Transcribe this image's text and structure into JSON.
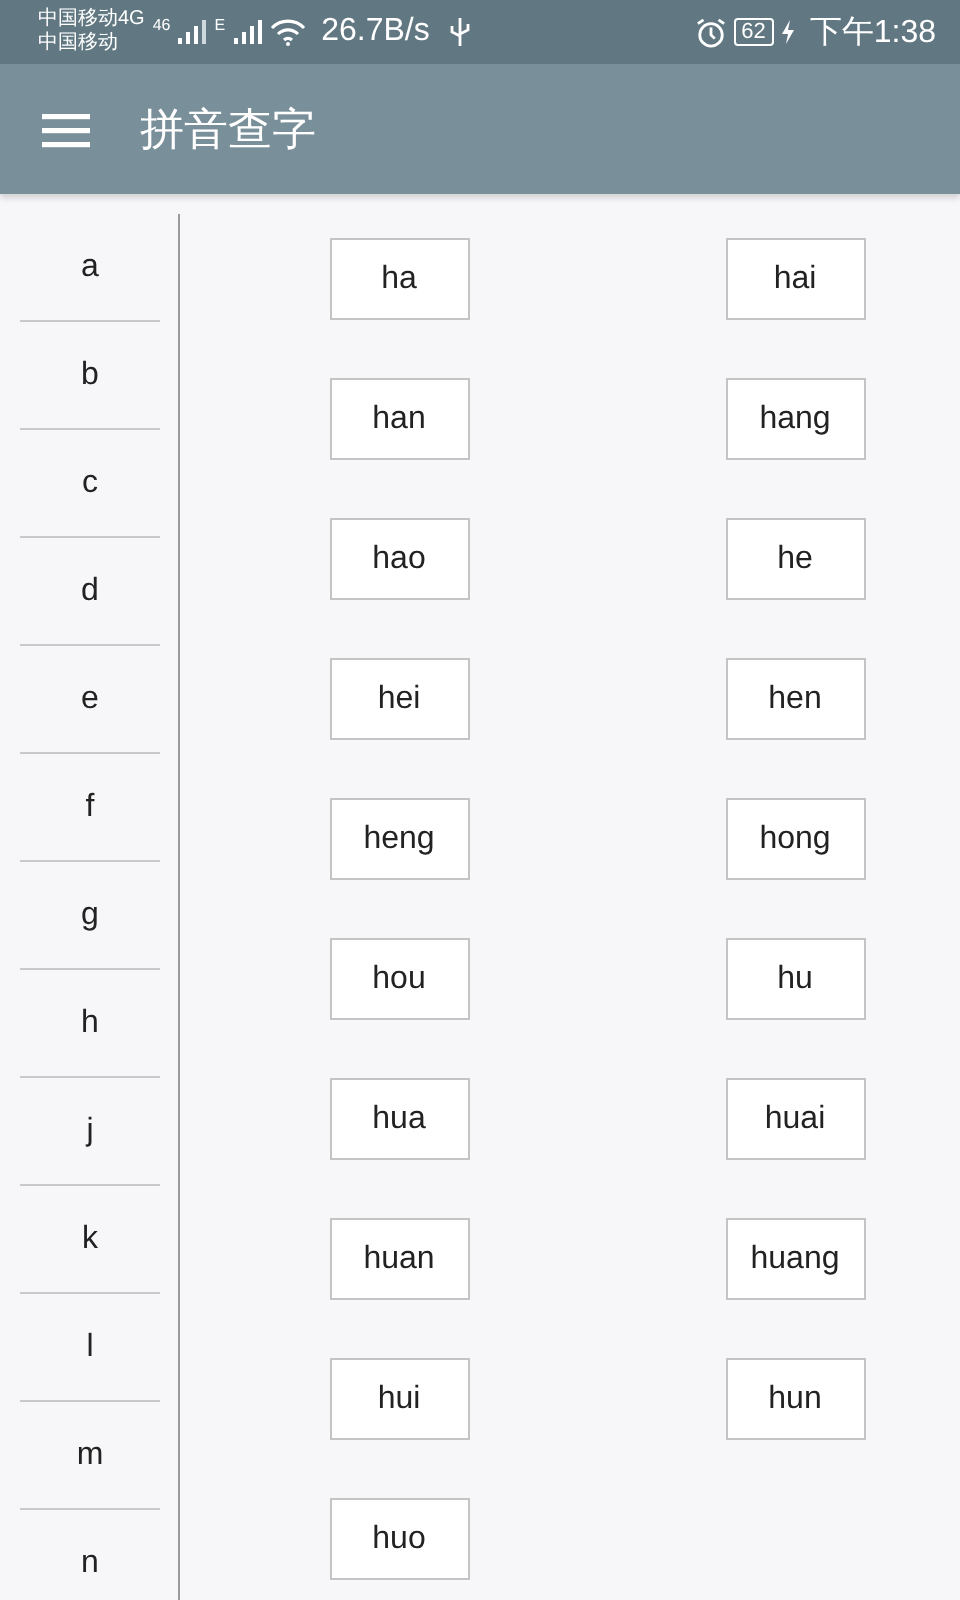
{
  "status_bar": {
    "carrier_1": "中国移动4G",
    "carrier_2": "中国移动",
    "network_1": "46",
    "network_2": "E",
    "speed": "26.7B/s",
    "battery": "62",
    "time": "下午1:38"
  },
  "app_bar": {
    "title": "拼音查字"
  },
  "letters": [
    "a",
    "b",
    "c",
    "d",
    "e",
    "f",
    "g",
    "h",
    "j",
    "k",
    "l",
    "m",
    "n"
  ],
  "syllables": [
    "ha",
    "hai",
    "han",
    "hang",
    "hao",
    "he",
    "hei",
    "hen",
    "heng",
    "hong",
    "hou",
    "hu",
    "hua",
    "huai",
    "huan",
    "huang",
    "hui",
    "hun",
    "huo"
  ]
}
